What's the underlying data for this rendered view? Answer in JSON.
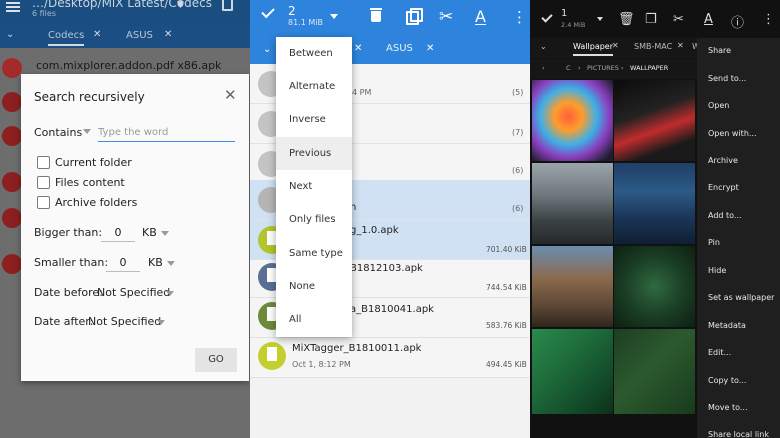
{
  "panel_left": {
    "header": {
      "path": "…/Desktop/MiX Latest/Codecs",
      "count": "6 files"
    },
    "tabs": [
      {
        "label": "Codecs",
        "close": "✕"
      },
      {
        "label": "ASUS",
        "close": "✕"
      }
    ],
    "first_row_label": "com.mixplorer.addon.pdf x86.apk",
    "dialog": {
      "title": "Search recursively",
      "close": "✕",
      "match_mode": "Contains",
      "word_placeholder": "Type the word",
      "options": [
        "Current folder",
        "Files content",
        "Archive folders"
      ],
      "bigger_label": "Bigger than:",
      "bigger_value": "0",
      "bigger_unit": "KB",
      "smaller_label": "Smaller than:",
      "smaller_value": "0",
      "smaller_unit": "KB",
      "date_before_label": "Date before:",
      "date_before_value": "Not Specified",
      "date_after_label": "Date after:",
      "date_after_value": "Not Specified",
      "go_label": "GO"
    }
  },
  "panel_mid": {
    "selection": {
      "count": "2",
      "size": "81.1 MiB"
    },
    "tabs": [
      {
        "label": "ASUS",
        "close": "✕"
      }
    ],
    "tab_close_partial": "✕",
    "rows": [
      {
        "date": "4 PM",
        "count": "(5)"
      },
      {
        "count": "(7)"
      },
      {
        "count": "(6)"
      },
      {
        "name": "n",
        "count": "(6)"
      },
      {
        "name": "g_1.0.apk",
        "size": "701.40 KiB"
      },
      {
        "name": "B1812103.apk",
        "size": "744.54 KiB"
      },
      {
        "name": "a_B1810041.apk",
        "size": "583.76 KiB"
      },
      {
        "name": "MiXTagger_B1810011.apk",
        "date": "Oct 1, 8:12 PM",
        "size": "494.45 KiB"
      }
    ],
    "menu": [
      "Between",
      "Alternate",
      "Inverse",
      "Previous",
      "Next",
      "Only files",
      "Same type",
      "None",
      "All"
    ],
    "menu_highlight": 3
  },
  "panel_right": {
    "selection": {
      "count": "1",
      "size": "2.4 MiB"
    },
    "tabs": [
      {
        "label": "Wallpaper",
        "close": "✕"
      },
      {
        "label": "SMB-MAC",
        "close": "✕"
      }
    ],
    "tab_partial": "W",
    "breadcrumb": [
      "C",
      "PICTURES",
      "WALLPAPER"
    ],
    "breadcrumb_arrow": "‹",
    "crumb_separator": "›",
    "context_menu": [
      "Share",
      "Send to...",
      "Open",
      "Open with...",
      "Archive",
      "Encrypt",
      "Add to...",
      "Pin",
      "Hide",
      "Set as wallpaper",
      "Metadata",
      "Edit...",
      "Copy to...",
      "Move to...",
      "Share local link"
    ]
  },
  "colors": {
    "accent_blue": "#2e84dc",
    "dialog_bg": "#fafafa",
    "header_dark_blue": "#1a4d80"
  },
  "icons": [
    "menu-icon",
    "check-icon",
    "trash-icon",
    "copy-icon",
    "cut-icon",
    "font-icon",
    "more-icon",
    "info-icon",
    "close-icon",
    "chevron-down-icon"
  ]
}
